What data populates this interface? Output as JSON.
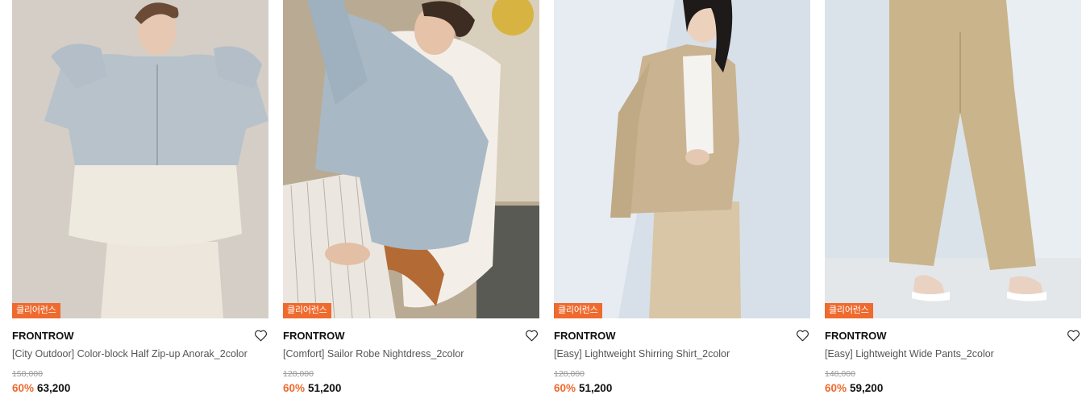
{
  "colors": {
    "accent": "#ef6a2e",
    "text": "#111111",
    "muted": "#9a9a9a"
  },
  "products": [
    {
      "badge": "클리어런스",
      "brand": "FRONTROW",
      "title": "[City Outdoor] Color-block Half Zip-up Anorak_2color",
      "original_price": "158,000",
      "discount": "60%",
      "price": "63,200",
      "wishlist_icon": "heart-outline-icon"
    },
    {
      "badge": "클리어런스",
      "brand": "FRONTROW",
      "title": "[Comfort] Sailor Robe Nightdress_2color",
      "original_price": "128,000",
      "discount": "60%",
      "price": "51,200",
      "wishlist_icon": "heart-outline-icon"
    },
    {
      "badge": "클리어런스",
      "brand": "FRONTROW",
      "title": "[Easy] Lightweight Shirring Shirt_2color",
      "original_price": "128,000",
      "discount": "60%",
      "price": "51,200",
      "wishlist_icon": "heart-outline-icon"
    },
    {
      "badge": "클리어런스",
      "brand": "FRONTROW",
      "title": "[Easy] Lightweight Wide Pants_2color",
      "original_price": "148,000",
      "discount": "60%",
      "price": "59,200",
      "wishlist_icon": "heart-outline-icon"
    }
  ]
}
